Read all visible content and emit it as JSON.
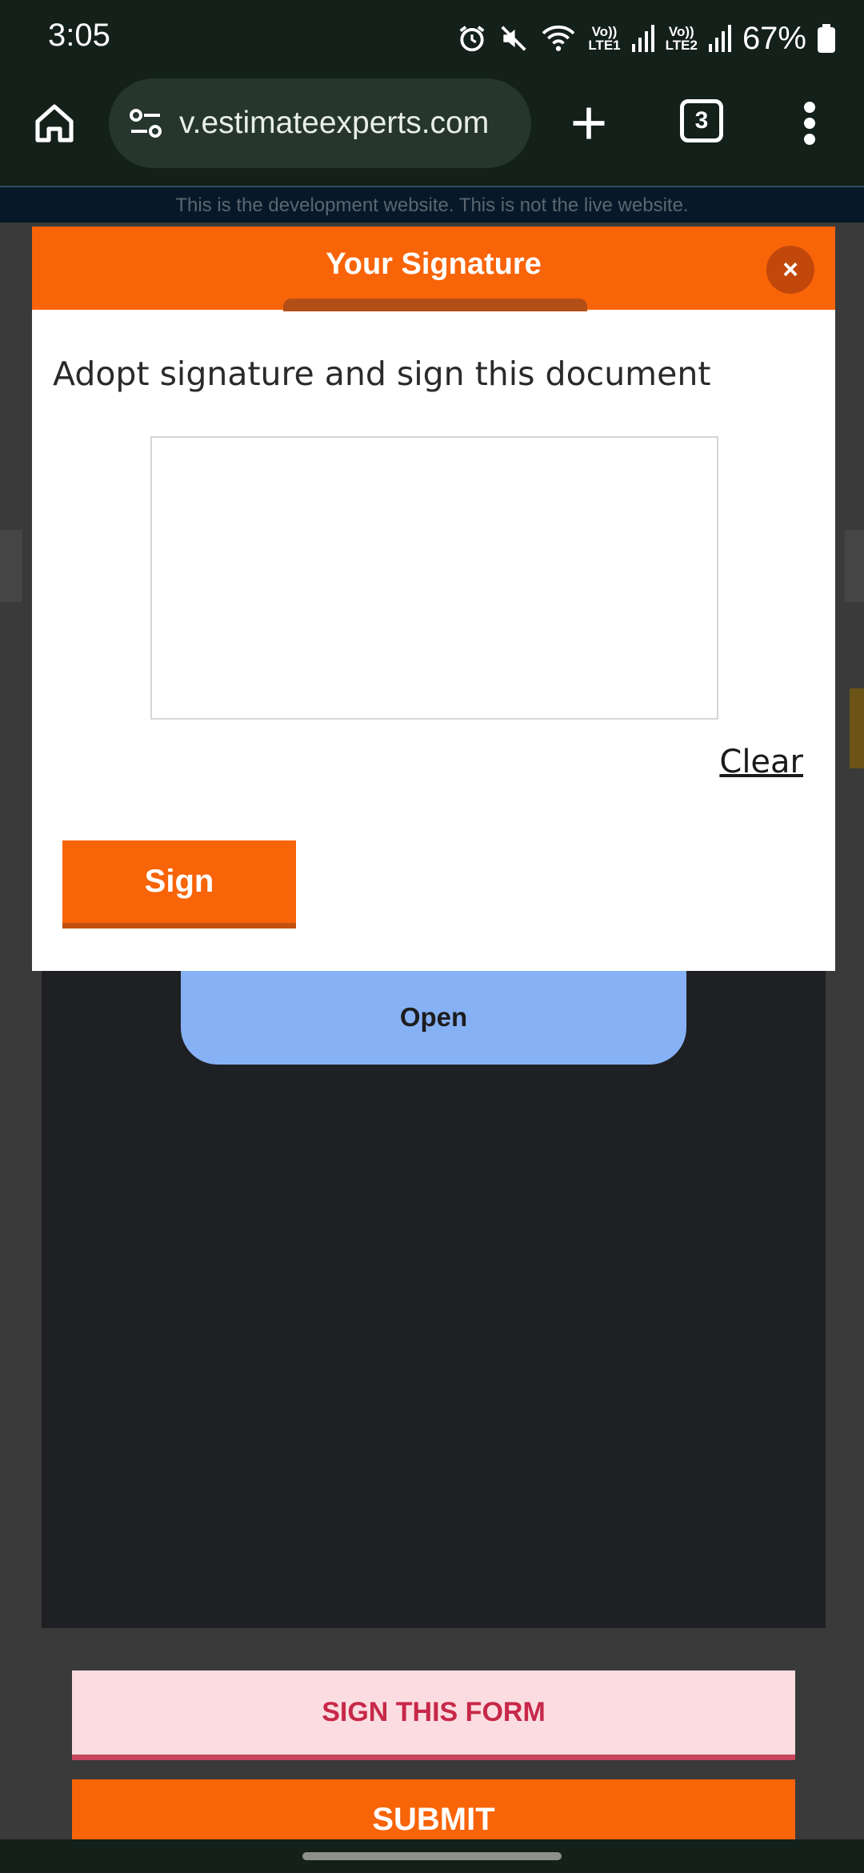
{
  "status_bar": {
    "time": "3:05",
    "icons": [
      "alarm-icon",
      "mute-icon",
      "wifi-icon",
      "signal-sim1-icon",
      "signal-sim2-icon",
      "battery-icon"
    ],
    "sim1_label_top": "Vo))",
    "sim1_label_bottom": "LTE1",
    "sim2_label_top": "Vo))",
    "sim2_label_bottom": "LTE2",
    "battery": "67%"
  },
  "browser": {
    "url": "v.estimateexperts.com",
    "tab_count": "3"
  },
  "page": {
    "dev_banner": "This is the development website. This is not the live website.",
    "open_button": "Open",
    "sign_form_button": "SIGN THIS FORM",
    "submit_button": "SUBMIT"
  },
  "modal": {
    "title": "Your Signature",
    "close_label": "×",
    "subtitle": "Adopt signature and sign this document",
    "clear_label": "Clear",
    "sign_label": "Sign"
  },
  "colors": {
    "accent": "#f86408",
    "open_button": "#86b1f5",
    "sign_form_text": "#c72848",
    "sign_form_bg": "#fbdde1"
  }
}
